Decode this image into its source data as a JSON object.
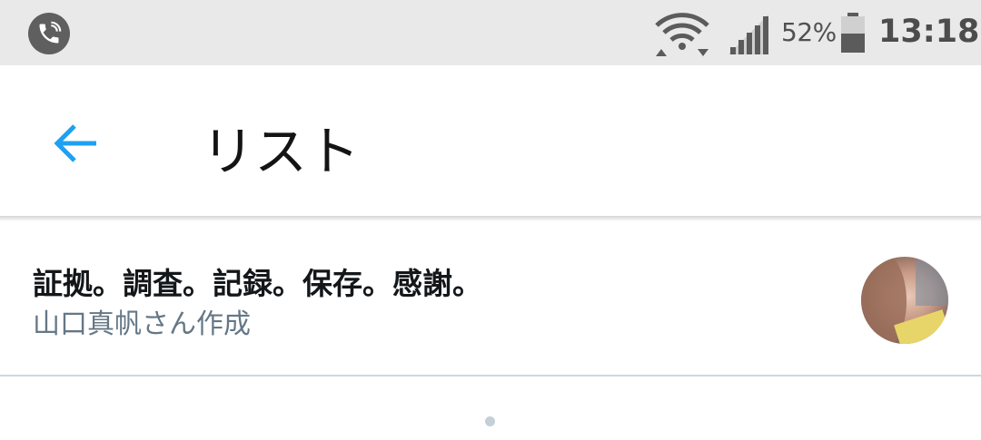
{
  "status_bar": {
    "battery_percent": "52%",
    "time": "13:18",
    "icons": [
      "call-icon",
      "wifi-icon",
      "signal-icon",
      "battery-icon"
    ],
    "battery_level": 0.52
  },
  "app_bar": {
    "back_icon": "arrow-left-icon",
    "title": "リスト",
    "accent_color": "#1da1f2"
  },
  "lists": [
    {
      "name": "証拠。調査。記録。保存。感謝。",
      "owner": "山口真帆さん作成",
      "avatar": "owner-avatar"
    }
  ],
  "colors": {
    "status_bar_bg": "#e9e9e9",
    "primary_text": "#14171a",
    "secondary_text": "#657786",
    "divider": "#ccd6dd"
  }
}
